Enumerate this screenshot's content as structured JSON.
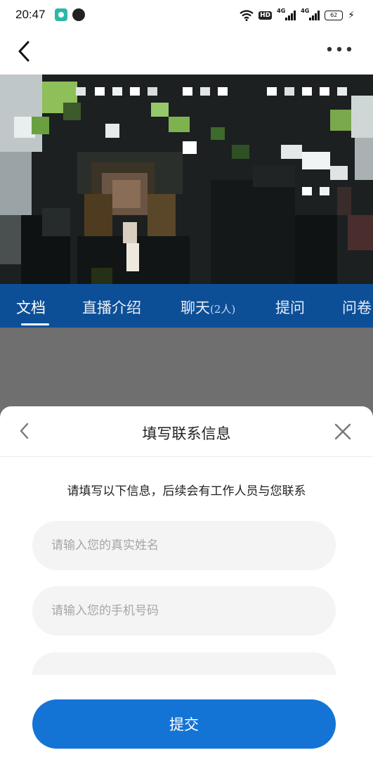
{
  "status_bar": {
    "time": "20:47",
    "icons": [
      "app-notification-icon",
      "app-notification-icon-2",
      "wifi-icon",
      "hd-icon",
      "signal-icon",
      "signal-icon",
      "battery-icon",
      "charging-icon"
    ],
    "hd_label": "HD",
    "signal1_label": "4G",
    "signal2_label": "4G",
    "battery_level": "62"
  },
  "nav": {
    "back_icon": "chevron-left-icon",
    "more_icon": "more-horizontal-icon"
  },
  "tabs": {
    "items": [
      {
        "label": "文档",
        "active": true
      },
      {
        "label": "直播介绍",
        "active": false
      },
      {
        "label": "聊天",
        "count": "(2人)",
        "active": false
      },
      {
        "label": "提问",
        "active": false
      },
      {
        "label": "问卷",
        "active": false
      }
    ]
  },
  "sheet": {
    "title": "填写联系信息",
    "back_icon": "chevron-left-icon",
    "close_icon": "close-icon",
    "description": "请填写以下信息，后续会有工作人员与您联系",
    "name_placeholder": "请输入您的真实姓名",
    "name_value": "",
    "phone_placeholder": "请输入您的手机号码",
    "phone_value": "",
    "third_placeholder": "",
    "submit_label": "提交"
  },
  "colors": {
    "tab_bar_bg": "#0d4f97",
    "submit_bg": "#1374d6",
    "field_bg": "#f4f4f4",
    "placeholder": "#a6a6a6",
    "backdrop": "#6f6f6f"
  }
}
